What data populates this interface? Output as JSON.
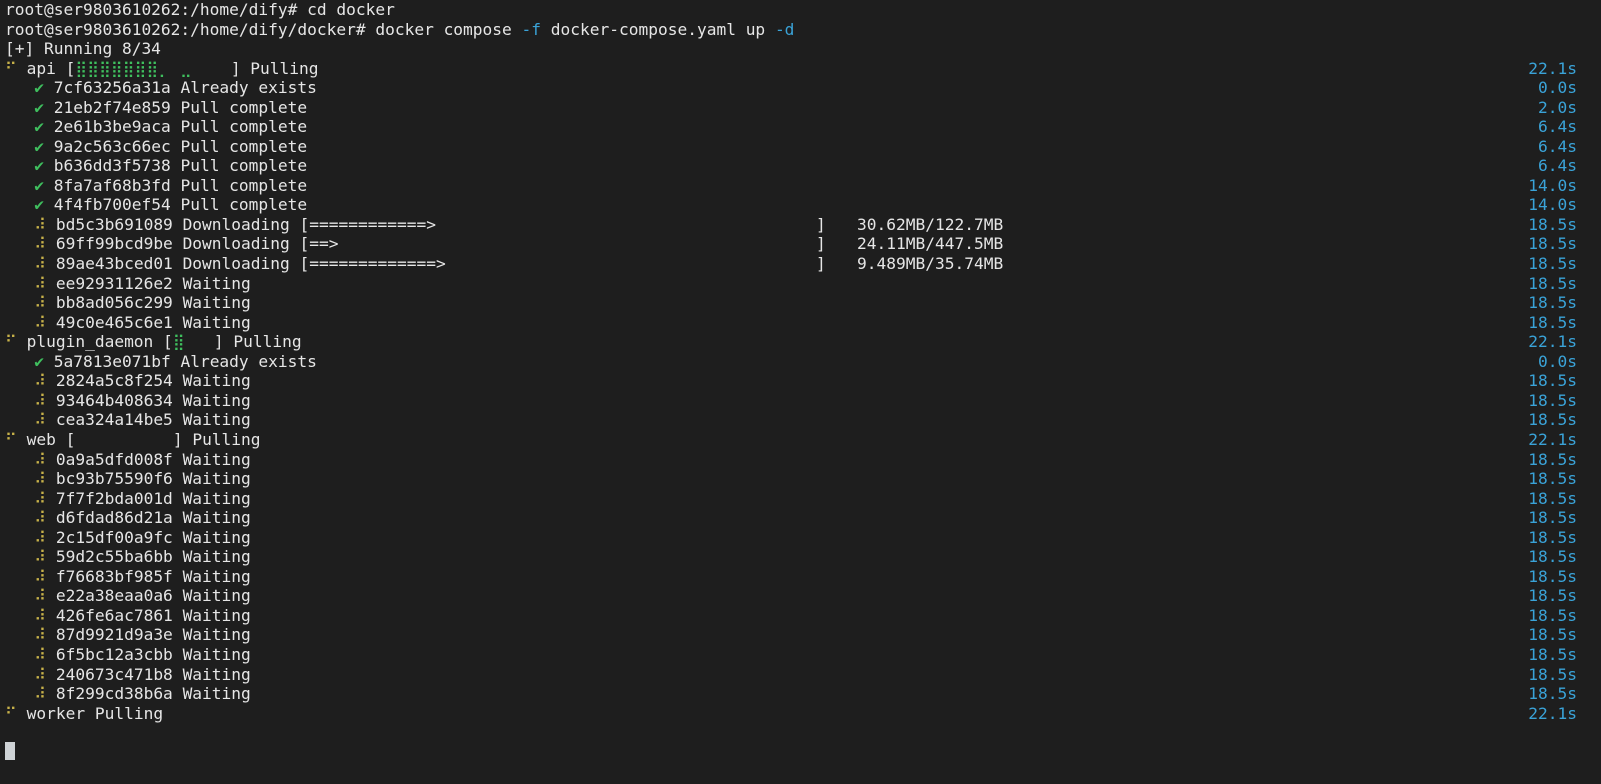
{
  "terminal": {
    "prompt1": "root@ser9803610262:/home/dify# ",
    "cmd1": "cd docker",
    "prompt2": "root@ser9803610262:/home/dify/docker# ",
    "cmd2a": "docker compose ",
    "flag_f": "-f",
    "cmd2b": " docker-compose.yaml up ",
    "flag_d": "-d",
    "running": "[+] Running 8/34"
  },
  "groups": {
    "api": {
      "icon": "⠋",
      "name": "api",
      "bar_open": " [",
      "bar_fill": "⣿⣿⣿⣿⣿⣿⣿⡀",
      "bar_tail": " ⣀    ",
      "bar_close": "] Pulling",
      "time": "22.1s"
    },
    "plugin_daemon": {
      "icon": "⠋",
      "name": "plugin_daemon",
      "bar_open": " [",
      "bar_fill": "⣿",
      "bar_tail": "   ",
      "bar_close": "] Pulling",
      "time": "22.1s"
    },
    "web": {
      "icon": "⠋",
      "name": "web",
      "bar_open": " [",
      "bar_fill": "",
      "bar_tail": "          ",
      "bar_close": "] Pulling",
      "time": "22.1s"
    },
    "worker": {
      "icon": "⠋",
      "name": "worker",
      "status": " Pulling",
      "time": "22.1s"
    }
  },
  "api_layers": [
    {
      "icon": "✔",
      "id": "7cf63256a31a",
      "status": "Already exists",
      "time": "0.0s"
    },
    {
      "icon": "✔",
      "id": "21eb2f74e859",
      "status": "Pull complete",
      "time": "2.0s"
    },
    {
      "icon": "✔",
      "id": "2e61b3be9aca",
      "status": "Pull complete",
      "time": "6.4s"
    },
    {
      "icon": "✔",
      "id": "9a2c563c66ec",
      "status": "Pull complete",
      "time": "6.4s"
    },
    {
      "icon": "✔",
      "id": "b636dd3f5738",
      "status": "Pull complete",
      "time": "6.4s"
    },
    {
      "icon": "✔",
      "id": "8fa7af68b3fd",
      "status": "Pull complete",
      "time": "14.0s"
    },
    {
      "icon": "✔",
      "id": "4f4fb700ef54",
      "status": "Pull complete",
      "time": "14.0s"
    },
    {
      "icon": "⠼",
      "id": "bd5c3b691089",
      "status": "Downloading [============>                                       ]",
      "size": "30.62MB/122.7MB",
      "time": "18.5s"
    },
    {
      "icon": "⠼",
      "id": "69ff99bcd9be",
      "status": "Downloading [==>                                                 ]",
      "size": "24.11MB/447.5MB",
      "time": "18.5s"
    },
    {
      "icon": "⠼",
      "id": "89ae43bced01",
      "status": "Downloading [=============>                                      ]",
      "size": "9.489MB/35.74MB",
      "time": "18.5s"
    },
    {
      "icon": "⠼",
      "id": "ee92931126e2",
      "status": "Waiting",
      "time": "18.5s"
    },
    {
      "icon": "⠼",
      "id": "bb8ad056c299",
      "status": "Waiting",
      "time": "18.5s"
    },
    {
      "icon": "⠼",
      "id": "49c0e465c6e1",
      "status": "Waiting",
      "time": "18.5s"
    }
  ],
  "plugin_layers": [
    {
      "icon": "✔",
      "id": "5a7813e071bf",
      "status": "Already exists",
      "time": "0.0s"
    },
    {
      "icon": "⠼",
      "id": "2824a5c8f254",
      "status": "Waiting",
      "time": "18.5s"
    },
    {
      "icon": "⠼",
      "id": "93464b408634",
      "status": "Waiting",
      "time": "18.5s"
    },
    {
      "icon": "⠼",
      "id": "cea324a14be5",
      "status": "Waiting",
      "time": "18.5s"
    }
  ],
  "web_layers": [
    {
      "icon": "⠼",
      "id": "0a9a5dfd008f",
      "status": "Waiting",
      "time": "18.5s"
    },
    {
      "icon": "⠼",
      "id": "bc93b75590f6",
      "status": "Waiting",
      "time": "18.5s"
    },
    {
      "icon": "⠼",
      "id": "7f7f2bda001d",
      "status": "Waiting",
      "time": "18.5s"
    },
    {
      "icon": "⠼",
      "id": "d6fdad86d21a",
      "status": "Waiting",
      "time": "18.5s"
    },
    {
      "icon": "⠼",
      "id": "2c15df00a9fc",
      "status": "Waiting",
      "time": "18.5s"
    },
    {
      "icon": "⠼",
      "id": "59d2c55ba6bb",
      "status": "Waiting",
      "time": "18.5s"
    },
    {
      "icon": "⠼",
      "id": "f76683bf985f",
      "status": "Waiting",
      "time": "18.5s"
    },
    {
      "icon": "⠼",
      "id": "e22a38eaa0a6",
      "status": "Waiting",
      "time": "18.5s"
    },
    {
      "icon": "⠼",
      "id": "426fe6ac7861",
      "status": "Waiting",
      "time": "18.5s"
    },
    {
      "icon": "⠼",
      "id": "87d9921d9a3e",
      "status": "Waiting",
      "time": "18.5s"
    },
    {
      "icon": "⠼",
      "id": "6f5bc12a3cbb",
      "status": "Waiting",
      "time": "18.5s"
    },
    {
      "icon": "⠼",
      "id": "240673c471b8",
      "status": "Waiting",
      "time": "18.5s"
    },
    {
      "icon": "⠼",
      "id": "8f299cd38b6a",
      "status": "Waiting",
      "time": "18.5s"
    }
  ],
  "theme": {
    "background": "#1e1e1e",
    "text": "#e6e6e6",
    "time_color": "#3aa3d8",
    "check_color": "#3fbf5e",
    "spinner_color": "#c8b24a",
    "flag_color": "#3aa3d8",
    "cursor_color": "#cfd3d6"
  }
}
